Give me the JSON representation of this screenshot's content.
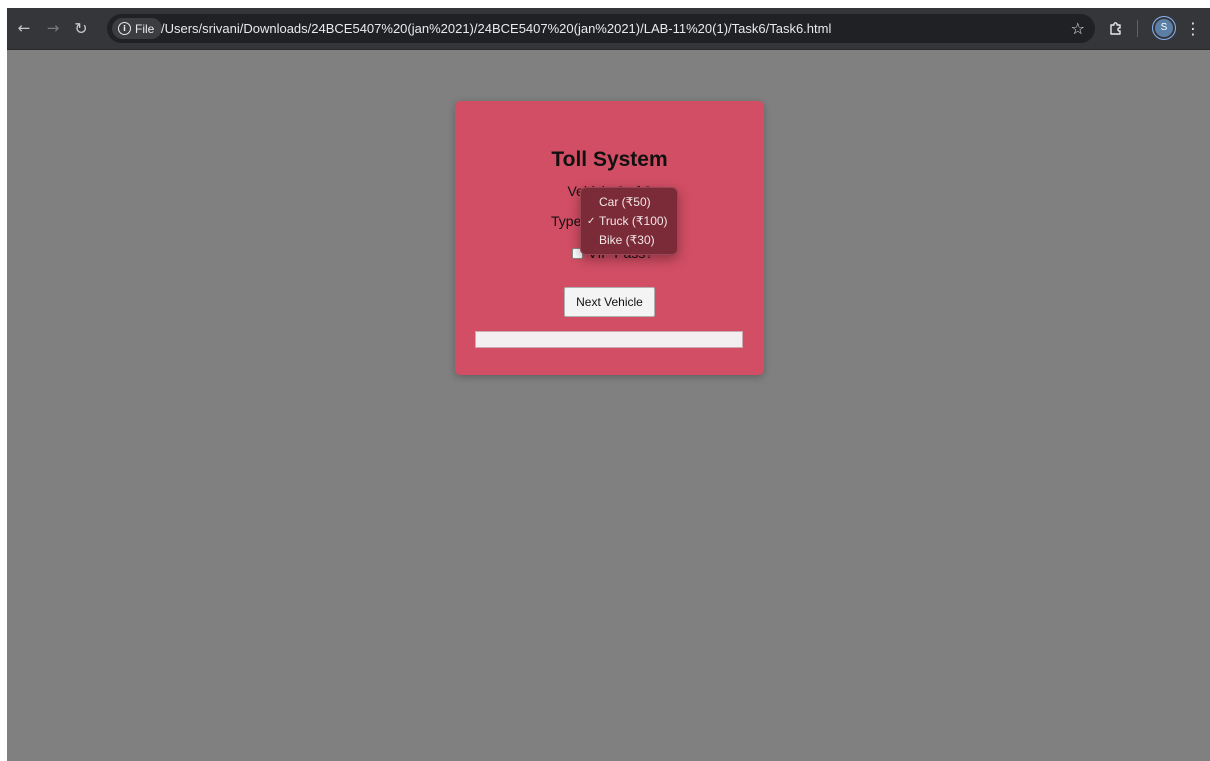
{
  "browser": {
    "back_icon": "←",
    "forward_icon": "→",
    "reload_icon": "↻",
    "site_info_label": "File",
    "url": "/Users/srivani/Downloads/24BCE5407%20(jan%2021)/24BCE5407%20(jan%2021)/LAB-11%20(1)/Task6/Task6.html",
    "bookmark_icon": "☆",
    "extensions_icon": "⬚",
    "profile_initial": "S",
    "menu_icon": "⋮"
  },
  "app": {
    "title": "Toll System",
    "vehicle_counter": "Vehicle 2 of 3",
    "type_label": "Type",
    "vip_label": "VIP Pass?",
    "vip_checked": false,
    "next_button_label": "Next Vehicle",
    "result_text": ""
  },
  "vehicle_select": {
    "options": [
      {
        "label": "Car (₹50)",
        "selected": false
      },
      {
        "label": "Truck (₹100)",
        "selected": true
      },
      {
        "label": "Bike (₹30)",
        "selected": false
      }
    ],
    "check_glyph": "✓"
  },
  "colors": {
    "page_background": "#808080",
    "card_background": "#d24e64",
    "dropdown_background": "#7b2b37",
    "toolbar_background": "#35363a"
  }
}
